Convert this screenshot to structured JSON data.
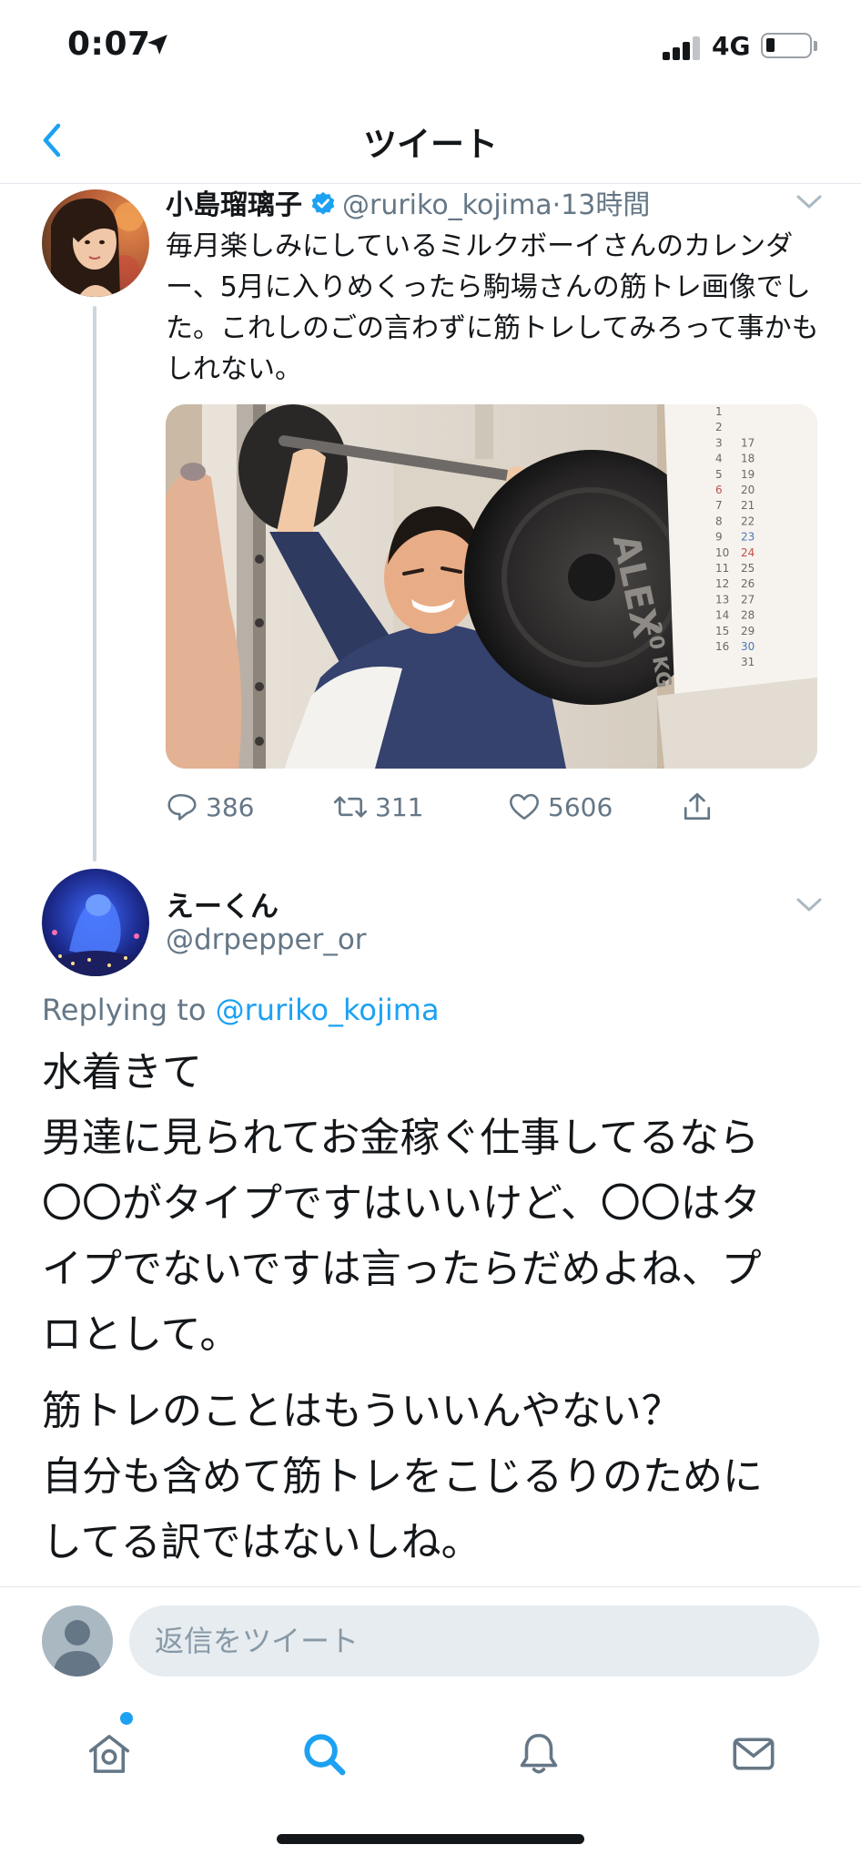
{
  "status_bar": {
    "time": "0:07",
    "network": "4G"
  },
  "header": {
    "title": "ツイート"
  },
  "tweet": {
    "author_name": "小島瑠璃子",
    "handle": "@ruriko_kojima",
    "time": "13時間",
    "separator": "·",
    "text": "毎月楽しみにしているミルクボーイさんのカレンダー、5月に入りめくったら駒場さんの筋トレ画像でした。これしのごの言わずに筋トレしてみろって事かもしれない。",
    "media": {
      "calendar_days": [
        [
          "1",
          ""
        ],
        [
          "2",
          ""
        ],
        [
          "3",
          "17"
        ],
        [
          "4",
          "18"
        ],
        [
          "5",
          "19"
        ],
        [
          "6",
          "20"
        ],
        [
          "7",
          "21"
        ],
        [
          "8",
          "22"
        ],
        [
          "9",
          "23"
        ],
        [
          "10",
          "24"
        ],
        [
          "11",
          "25"
        ],
        [
          "12",
          "26"
        ],
        [
          "13",
          "27"
        ],
        [
          "14",
          "28"
        ],
        [
          "15",
          "29"
        ],
        [
          "16",
          "30"
        ],
        [
          "",
          "31"
        ]
      ],
      "plate_text": "ALEX",
      "plate_weight": "20 KG"
    },
    "stats": {
      "replies": "386",
      "retweets": "311",
      "likes": "5606"
    }
  },
  "reply": {
    "author_name": "えーくん",
    "handle": "@drpepper_or",
    "replying_to_prefix": "Replying to",
    "replying_to_handle": "@ruriko_kojima",
    "paragraph1_lines": [
      "水着きて",
      "男達に見られてお金稼ぐ仕事してるなら",
      "〇〇がタイプですはいいけど、〇〇はタ",
      "イプでないですは言ったらだめよね、プ",
      "ロとして。"
    ],
    "paragraph2_lines": [
      "筋トレのことはもういいんやない？",
      "自分も含めて筋トレをこじるりのために",
      "してる訳ではないしね。"
    ]
  },
  "composer": {
    "placeholder": "返信をツイート"
  },
  "tabbar": {
    "items": [
      "home-icon",
      "search-icon",
      "notifications-icon",
      "messages-icon"
    ],
    "active": "search-icon"
  },
  "colors": {
    "accent": "#1da1f2",
    "text": "#14171a",
    "secondary": "#657786",
    "divider": "#e1e8ed"
  }
}
